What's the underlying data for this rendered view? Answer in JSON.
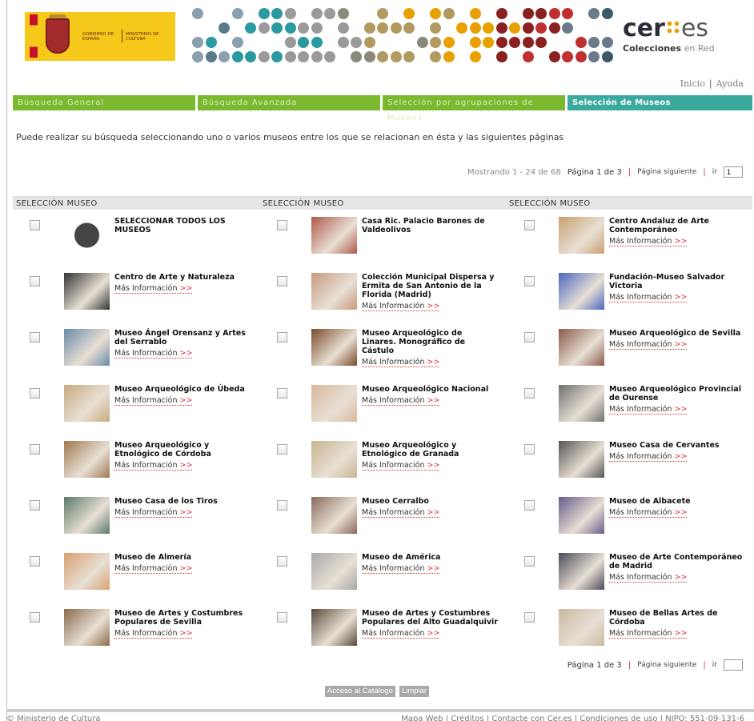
{
  "header": {
    "gov_logo": {
      "line1": "GOBIERNO DE ESPAÑA",
      "line2": "MINISTERIO DE CULTURA"
    },
    "brand": {
      "name_a": "cer",
      "name_b": "es",
      "sub_a": "Colecciones",
      "sub_b": "en Red"
    },
    "links": [
      "Inicio",
      "Ayuda"
    ]
  },
  "tabs": [
    {
      "label": "Búsqueda General"
    },
    {
      "label": "Búsqueda Avanzada"
    },
    {
      "label": "Selección por agrupaciones de Museos"
    },
    {
      "label": "Selección de Museos"
    }
  ],
  "intro": "Puede realizar su búsqueda seleccionando uno o varios museos entre los que se relacionan en ésta y las siguientes páginas",
  "pager_top": {
    "showing": "Mostrando 1 - 24 de 68",
    "page": "Página 1 de 3",
    "next": "Página siguiente",
    "ir": "ir",
    "page_value": "1"
  },
  "pager_bottom": {
    "page": "Página 1 de 3",
    "next": "Página siguiente",
    "ir": "ir",
    "page_value": ""
  },
  "columns": {
    "select": "SELECCIÓN",
    "museum": "MUSEO"
  },
  "more_label": "Más Información",
  "more_arrow": ">>",
  "museums": [
    {
      "name": "SELECCIONAR TODOS LOS MUSEOS",
      "more": false
    },
    {
      "name": "Casa Ric. Palacio Barones de Valdeolivos",
      "more": false
    },
    {
      "name": "Centro Andaluz de Arte Contemporáneo",
      "more": true
    },
    {
      "name": "Centro de Arte y Naturaleza",
      "more": true
    },
    {
      "name": "Colección Municipal Dispersa y Ermita de San Antonio de la Florida (Madrid)",
      "more": true
    },
    {
      "name": "Fundación-Museo Salvador Victoria",
      "more": true
    },
    {
      "name": "Museo Ángel Orensanz y Artes del Serrablo",
      "more": true
    },
    {
      "name": "Museo Arqueológico de Linares. Monográfico de Cástulo",
      "more": true
    },
    {
      "name": "Museo Arqueológico de Sevilla",
      "more": true
    },
    {
      "name": "Museo Arqueológico de Úbeda",
      "more": true
    },
    {
      "name": "Museo Arqueológico Nacional",
      "more": true
    },
    {
      "name": "Museo Arqueológico Provincial de Ourense",
      "more": true
    },
    {
      "name": "Museo Arqueológico y Etnológico de Córdoba",
      "more": true
    },
    {
      "name": "Museo Arqueológico y Etnológico de Granada",
      "more": true
    },
    {
      "name": "Museo Casa de Cervantes",
      "more": true
    },
    {
      "name": "Museo Casa de los Tiros",
      "more": true
    },
    {
      "name": "Museo Cerralbo",
      "more": true
    },
    {
      "name": "Museo de Albacete",
      "more": true
    },
    {
      "name": "Museo de Almería",
      "more": true
    },
    {
      "name": "Museo de América",
      "more": true
    },
    {
      "name": "Museo de Arte Contemporáneo de Madrid",
      "more": true
    },
    {
      "name": "Museo de Artes y Costumbres Populares de Sevilla",
      "more": true
    },
    {
      "name": "Museo de Artes y Costumbres Populares del Alto Guadalquivir",
      "more": true
    },
    {
      "name": "Museo de Bellas Artes de Córdoba",
      "more": true
    }
  ],
  "thumb_colors": [
    "#6b6b6b",
    "#b0574a",
    "#c8a070",
    "#333333",
    "#c89a80",
    "#4a66c0",
    "#6a8aa8",
    "#7a4a2a",
    "#8a5a4a",
    "#c8a880",
    "#d8b8a0",
    "#707070",
    "#a07850",
    "#c8b490",
    "#555555",
    "#5a7a6a",
    "#8a6a5a",
    "#6a5a8a",
    "#d8a070",
    "#a8a8a8",
    "#4a4a5a",
    "#8a6a4a",
    "#5a4a3a",
    "#c8b8a0"
  ],
  "buttons": {
    "catalog": "Acceso al Catálogo",
    "clear": "Limpiar"
  },
  "footer": {
    "copy": "© Ministerio de Cultura",
    "links": "Mapa Web | Créditos | Contacte con Cer.es | Condiciones de uso | NIPO: 551-09-131-6"
  }
}
